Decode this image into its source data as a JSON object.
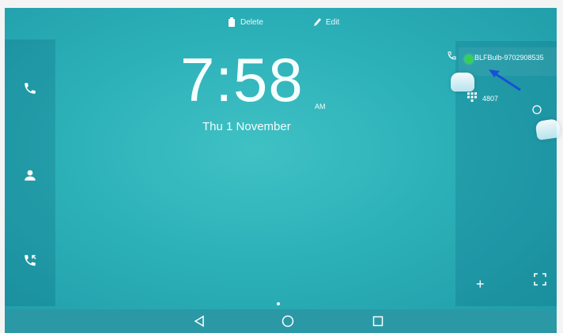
{
  "topbar": {
    "delete_label": "Delete",
    "edit_label": "Edit"
  },
  "clock": {
    "time": "7:58",
    "ampm": "AM",
    "date": "Thu 1 November"
  },
  "panel": {
    "contacts": [
      {
        "label": "BLF",
        "value": "Bulb-9702908535"
      },
      {
        "value": "4807"
      }
    ],
    "add_label": "+"
  },
  "colors": {
    "background": "#2cb0b8",
    "status_green": "#34d24c",
    "pointer_arrow": "#1a4fd6"
  },
  "icons": {
    "sidebar": [
      "phone-icon",
      "contacts-icon",
      "call-history-icon"
    ],
    "nav": [
      "back-icon",
      "home-icon",
      "recents-icon"
    ]
  }
}
